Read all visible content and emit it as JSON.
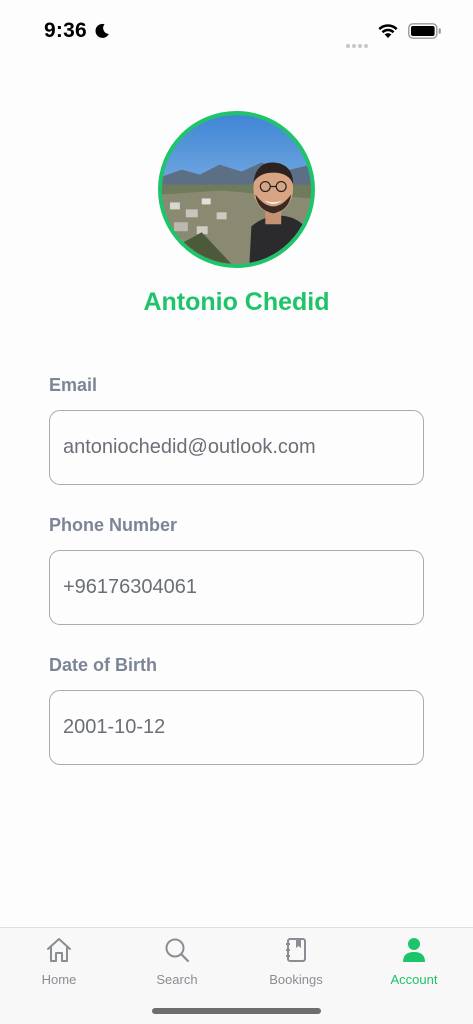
{
  "status_bar": {
    "time": "9:36"
  },
  "profile": {
    "name": "Antonio Chedid"
  },
  "fields": {
    "email": {
      "label": "Email",
      "value": "antoniochedid@outlook.com"
    },
    "phone": {
      "label": "Phone Number",
      "value": "+96176304061"
    },
    "dob": {
      "label": "Date of Birth",
      "value": "2001-10-12"
    }
  },
  "tabs": [
    {
      "label": "Home",
      "icon": "home-icon",
      "active": false
    },
    {
      "label": "Search",
      "icon": "search-icon",
      "active": false
    },
    {
      "label": "Bookings",
      "icon": "bookings-icon",
      "active": false
    },
    {
      "label": "Account",
      "icon": "account-icon",
      "active": true
    }
  ],
  "colors": {
    "accent": "#1ec46a",
    "label": "#7b8595",
    "field_text": "#6b6f76",
    "inactive_tab": "#8a8d93"
  }
}
